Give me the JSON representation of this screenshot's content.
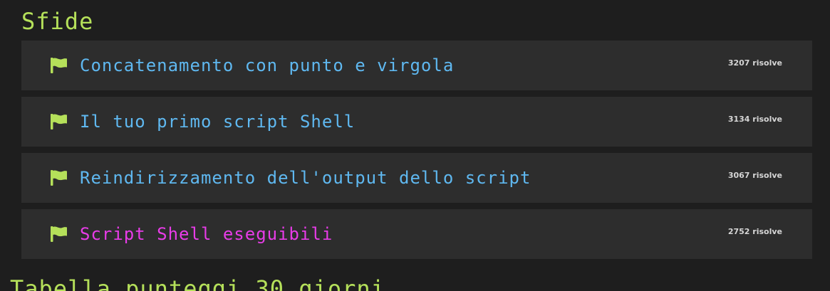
{
  "theme": {
    "background": "#1e1e1e",
    "row_background": "#2d2d2d",
    "title_color": "#b5e05a",
    "link_color": "#5fb8f0",
    "active_link_color": "#e83ce8",
    "flag_color": "#b5e05a"
  },
  "section": {
    "title": "Sfide"
  },
  "challenges": [
    {
      "title": "Concatenamento con punto e virgola",
      "solves": "3207",
      "solves_label": "risolve",
      "icon": "flag-icon",
      "active": false
    },
    {
      "title": "Il tuo primo script Shell",
      "solves": "3134",
      "solves_label": "risolve",
      "icon": "flag-icon",
      "active": false
    },
    {
      "title": "Reindirizzamento dell'output dello script",
      "solves": "3067",
      "solves_label": "risolve",
      "icon": "flag-icon",
      "active": false
    },
    {
      "title": "Script Shell eseguibili",
      "solves": "2752",
      "solves_label": "risolve",
      "icon": "flag-icon",
      "active": true
    }
  ],
  "next_section": {
    "title": "Tabella punteggi 30 giorni"
  }
}
